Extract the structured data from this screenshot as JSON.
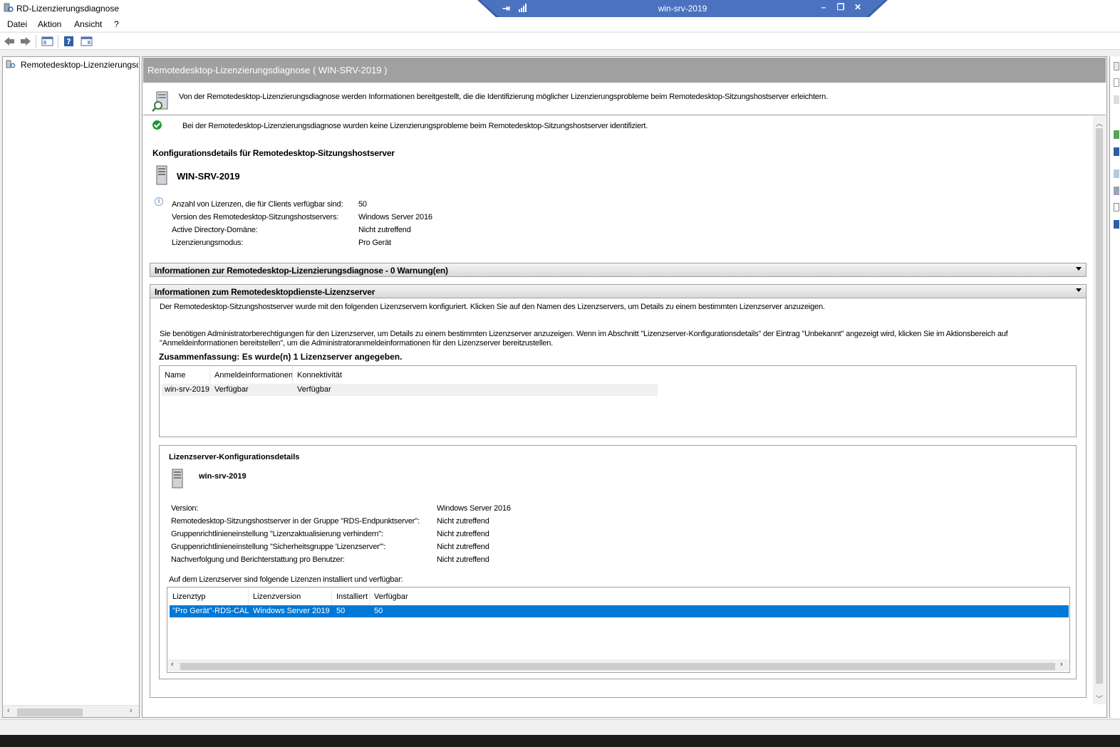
{
  "window": {
    "title": "RD-Lizenzierungsdiagnose"
  },
  "rdp_bar": {
    "host": "win-srv-2019"
  },
  "menu": {
    "file": "Datei",
    "action": "Aktion",
    "view": "Ansicht",
    "help": "?"
  },
  "tree": {
    "root_label": "Remotedesktop-Lizenzierungsdiagnose"
  },
  "main": {
    "header": "Remotedesktop-Lizenzierungsdiagnose ( WIN-SRV-2019 )",
    "intro": "Von der Remotedesktop-Lizenzierungsdiagnose werden Informationen bereitgestellt, die die Identifizierung möglicher Lizenzierungsprobleme beim Remotedesktop-Sitzungshostserver erleichtern.",
    "status": "Bei der Remotedesktop-Lizenzierungsdiagnose wurden keine Lizenzierungsprobleme beim Remotedesktop-Sitzungshostserver identifiziert.",
    "config_title": "Konfigurationsdetails für Remotedesktop-Sitzungshostserver",
    "server_name": "WIN-SRV-2019",
    "config_rows": [
      {
        "label": "Anzahl von Lizenzen, die für Clients verfügbar sind:",
        "value": "50"
      },
      {
        "label": "Version des Remotedesktop-Sitzungshostservers:",
        "value": "Windows Server 2016"
      },
      {
        "label": "Active Directory-Domäne:",
        "value": "Nicht zutreffend"
      },
      {
        "label": "Lizenzierungsmodus:",
        "value": "Pro Gerät"
      }
    ],
    "expander_diag": "Informationen zur Remotedesktop-Lizenzierungsdiagnose - 0 Warnung(en)",
    "expander_ls": "Informationen zum Remotedesktopdienste-Lizenzserver",
    "ls_text1": "Der Remotedesktop-Sitzungshostserver wurde mit den folgenden Lizenzservern konfiguriert. Klicken Sie auf den Namen des Lizenzservers, um Details zu einem bestimmten Lizenzserver anzuzeigen.",
    "ls_text2a": "Sie benötigen Administratorberechtigungen für den Lizenzserver, um Details zu einem bestimmten Lizenzserver anzuzeigen. Wenn im Abschnitt \"Lizenzserver-Konfigurationsdetails\" der Eintrag \"Unbekannt\" angezeigt wird, klicken Sie im Aktionsbereich auf",
    "ls_text2b": "\"Anmeldeinformationen bereitstellen\", um die Administratoranmeldeinformationen für den Lizenzserver bereitzustellen.",
    "summary": "Zusammenfassung: Es wurde(n) 1 Lizenzserver angegeben.",
    "ls_table": {
      "headers": [
        "Name",
        "Anmeldeinformationen",
        "Konnektivität"
      ],
      "row": [
        "win-srv-2019",
        "Verfügbar",
        "Verfügbar"
      ]
    },
    "ls_details": {
      "title": "Lizenzserver-Konfigurationsdetails",
      "server_name": "win-srv-2019",
      "rows": [
        {
          "label": "Version:",
          "value": "Windows Server 2016"
        },
        {
          "label": "Remotedesktop-Sitzungshostserver in der Gruppe \"RDS-Endpunktserver\":",
          "value": "Nicht zutreffend"
        },
        {
          "label": "Gruppenrichtlinieneinstellung \"Lizenzaktualisierung verhindern\":",
          "value": "Nicht zutreffend"
        },
        {
          "label": "Gruppenrichtlinieneinstellung \"Sicherheitsgruppe 'Lizenzserver'\":",
          "value": "Nicht zutreffend"
        },
        {
          "label": "Nachverfolgung und Berichterstattung pro Benutzer:",
          "value": "Nicht zutreffend"
        }
      ],
      "licenses_caption": "Auf dem Lizenzserver sind folgende Lizenzen installiert und verfügbar:",
      "licenses_headers": [
        "Lizenztyp",
        "Lizenzversion",
        "Installiert",
        "Verfügbar"
      ],
      "licenses_row": [
        "\"Pro Gerät\"-RDS-CAL",
        "Windows Server 2019",
        "50",
        "50"
      ]
    }
  },
  "colors": {
    "header_bg": "#a0a0a0",
    "selection": "#0078d7",
    "rdp_bar": "#3a5fa6",
    "ok_green": "#1f9a33"
  }
}
